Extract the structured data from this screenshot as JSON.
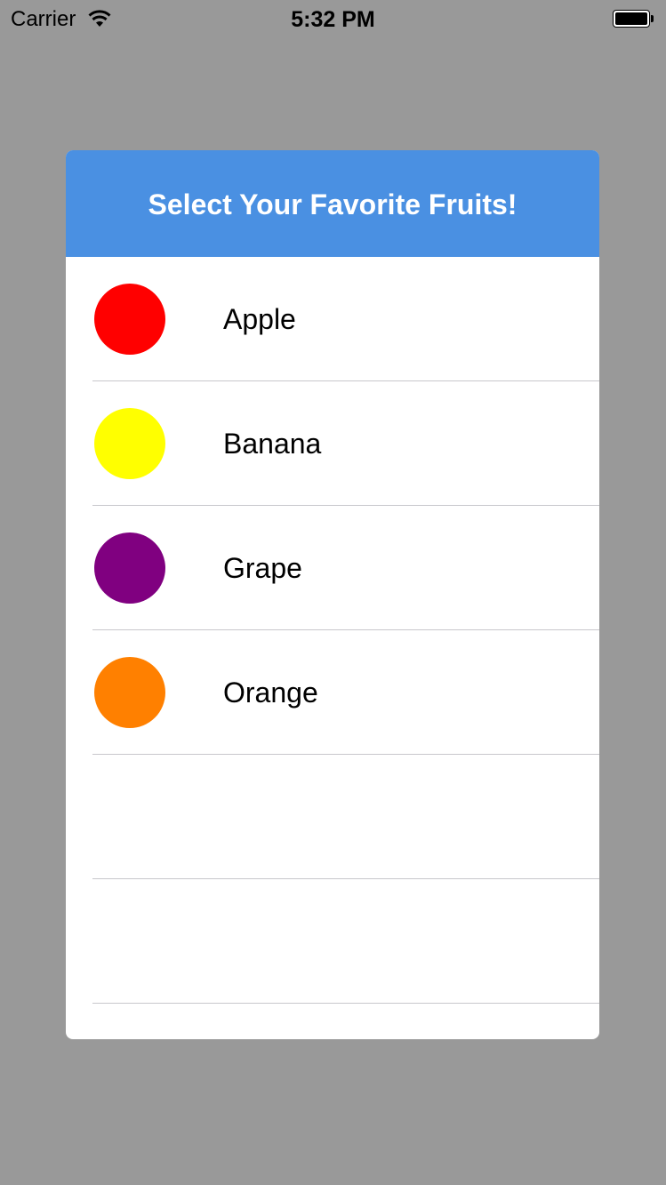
{
  "status_bar": {
    "carrier": "Carrier",
    "time": "5:32 PM",
    "wifi_icon": "wifi-icon",
    "battery_icon": "battery-icon",
    "battery_level": 1.0
  },
  "dialog": {
    "title": "Select Your Favorite Fruits!",
    "header_color": "#4a90e2",
    "fruits": [
      {
        "label": "Apple",
        "color": "#ff0000"
      },
      {
        "label": "Banana",
        "color": "#ffff00"
      },
      {
        "label": "Grape",
        "color": "#800080"
      },
      {
        "label": "Orange",
        "color": "#ff8000"
      },
      {
        "label": "",
        "color": ""
      },
      {
        "label": "",
        "color": ""
      }
    ]
  }
}
